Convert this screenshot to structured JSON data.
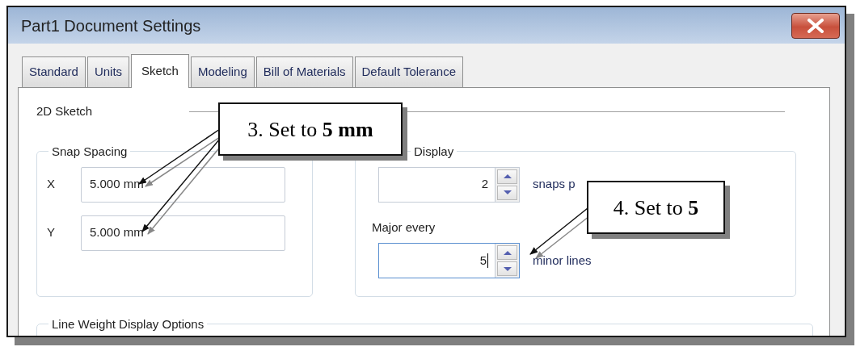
{
  "window": {
    "title": "Part1 Document Settings"
  },
  "tabs": [
    {
      "label": "Standard",
      "selected": false
    },
    {
      "label": "Units",
      "selected": false
    },
    {
      "label": "Sketch",
      "selected": true
    },
    {
      "label": "Modeling",
      "selected": false
    },
    {
      "label": "Bill of Materials",
      "selected": false
    },
    {
      "label": "Default Tolerance",
      "selected": false
    }
  ],
  "sketch_section": {
    "title": "2D Sketch"
  },
  "snap_spacing": {
    "title": "Snap Spacing",
    "fields": [
      {
        "label": "X",
        "value": "5.000 mm"
      },
      {
        "label": "Y",
        "value": "5.000 mm"
      }
    ]
  },
  "grid_display": {
    "title": "Display",
    "spins": [
      {
        "value": "2",
        "label": "snaps p",
        "focused": false
      },
      {
        "caption": "Major every",
        "value": "5",
        "label": "minor lines",
        "focused": true
      }
    ]
  },
  "line_weight": {
    "title": "Line Weight Display Options"
  },
  "callouts": [
    {
      "text": "3. Set to **5 mm**"
    },
    {
      "text": "4. Set to **5**"
    }
  ]
}
